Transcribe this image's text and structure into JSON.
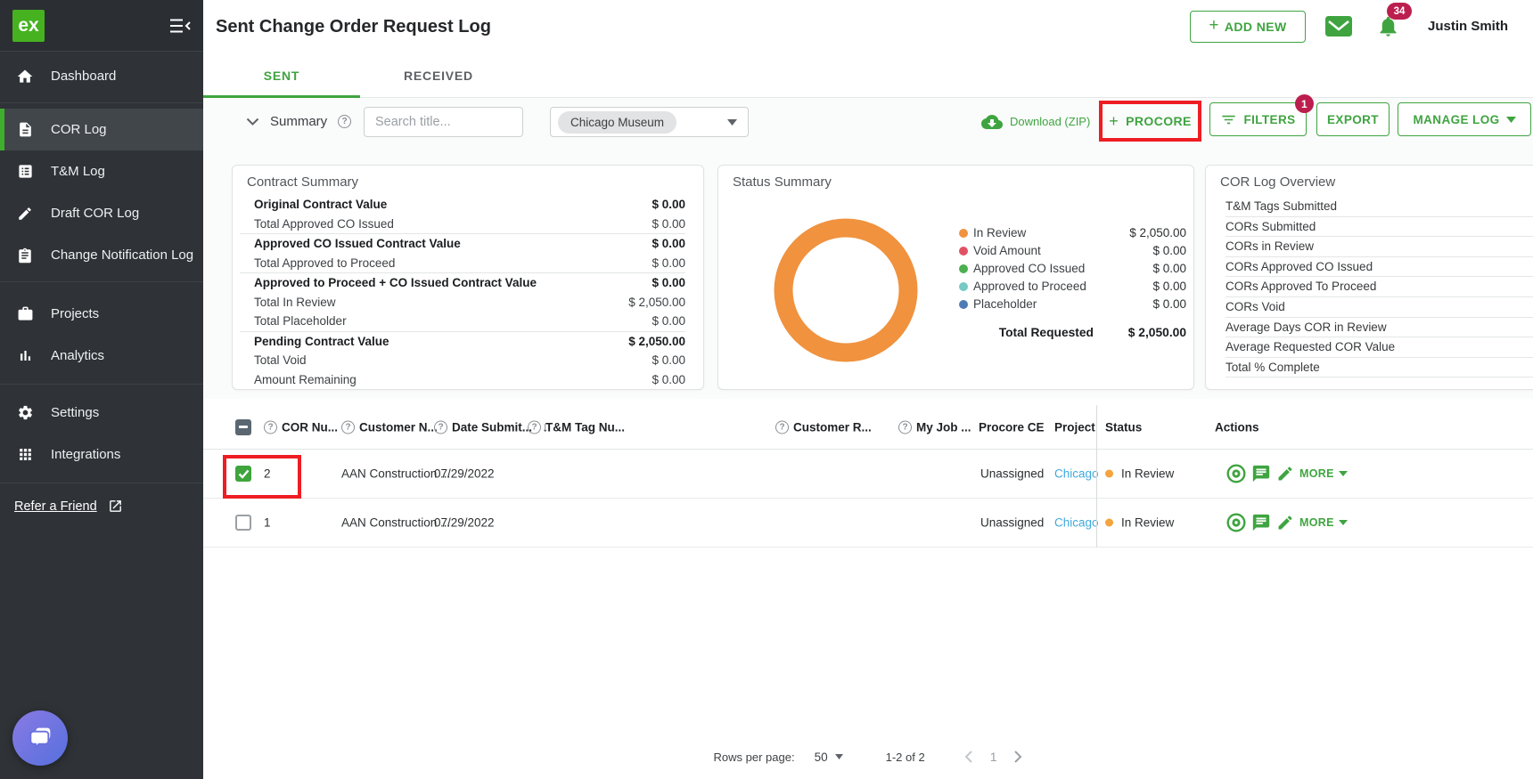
{
  "colors": {
    "accent_green": "#3fa440",
    "logo_green": "#46b220",
    "badge_crimson": "#bc1e4e",
    "annotation_red": "#ee1d23",
    "link_blue": "#3fa9db",
    "status_orange": "#f5a33c",
    "donut_orange": "#f0923e"
  },
  "icons": {
    "plus": "+",
    "sort_desc": "↓",
    "help": "?"
  },
  "app": {
    "logo_text": "ex",
    "user_name": "Justin Smith",
    "notification_count": "34"
  },
  "header": {
    "title": "Sent Change Order Request Log",
    "add_new_label": "ADD NEW"
  },
  "sidebar": {
    "groups": [
      {
        "items": [
          {
            "label": "Dashboard",
            "icon": "home"
          }
        ]
      },
      {
        "items": [
          {
            "label": "COR Log",
            "icon": "document",
            "active": true
          },
          {
            "label": "T&M Log",
            "icon": "list"
          },
          {
            "label": "Draft COR Log",
            "icon": "pencil"
          },
          {
            "label": "Change Notification Log",
            "icon": "clipboard"
          }
        ]
      },
      {
        "items": [
          {
            "label": "Projects",
            "icon": "briefcase"
          },
          {
            "label": "Analytics",
            "icon": "bar-chart"
          }
        ]
      },
      {
        "items": [
          {
            "label": "Settings",
            "icon": "gear"
          },
          {
            "label": "Integrations",
            "icon": "grid"
          }
        ]
      }
    ],
    "refer_label": "Refer a Friend"
  },
  "tabs": [
    {
      "label": "SENT",
      "active": true
    },
    {
      "label": "RECEIVED",
      "active": false
    }
  ],
  "toolbar": {
    "summary_label": "Summary",
    "search_placeholder": "Search title...",
    "project_filter_value": "Chicago Museum",
    "download_label": "Download (ZIP)",
    "procore_label": "PROCORE",
    "filters_label": "FILTERS",
    "filters_badge": "1",
    "export_label": "EXPORT",
    "manage_log_label": "MANAGE LOG"
  },
  "contract_summary": {
    "title": "Contract Summary",
    "rows": [
      {
        "label": "Original Contract Value",
        "value": "$ 0.00",
        "bold": true
      },
      {
        "label": "Total Approved CO Issued",
        "value": "$ 0.00"
      },
      {
        "label": "Approved CO Issued Contract Value",
        "value": "$ 0.00",
        "bold": true
      },
      {
        "label": "Total Approved to Proceed",
        "value": "$ 0.00"
      },
      {
        "label": "Approved to Proceed + CO Issued Contract Value",
        "value": "$ 0.00",
        "bold": true
      },
      {
        "label": "Total In Review",
        "value": "$ 2,050.00"
      },
      {
        "label": "Total Placeholder",
        "value": "$ 0.00"
      },
      {
        "label": "Pending Contract Value",
        "value": "$ 2,050.00",
        "bold": true
      },
      {
        "label": "Total Void",
        "value": "$ 0.00"
      },
      {
        "label": "Amount Remaining",
        "value": "$ 0.00"
      }
    ]
  },
  "status_summary": {
    "title": "Status Summary",
    "legend": [
      {
        "label": "In Review",
        "value": "$ 2,050.00",
        "color": "#f0923e"
      },
      {
        "label": "Void Amount",
        "value": "$ 0.00",
        "color": "#e05263"
      },
      {
        "label": "Approved CO Issued",
        "value": "$ 0.00",
        "color": "#4caf50"
      },
      {
        "label": "Approved to Proceed",
        "value": "$ 0.00",
        "color": "#76c9c5"
      },
      {
        "label": "Placeholder",
        "value": "$ 0.00",
        "color": "#4e7ab5"
      }
    ],
    "total_label": "Total Requested",
    "total_value": "$ 2,050.00",
    "chart_data": {
      "type": "pie",
      "donut": true,
      "title": "Status Summary",
      "labels": [
        "In Review",
        "Void Amount",
        "Approved CO Issued",
        "Approved to Proceed",
        "Placeholder"
      ],
      "values": [
        2050,
        0,
        0,
        0,
        0
      ],
      "colors": [
        "#f0923e",
        "#e05263",
        "#4caf50",
        "#76c9c5",
        "#4e7ab5"
      ],
      "total_label": "Total Requested",
      "total_value": 2050,
      "legend_position": "right"
    }
  },
  "cor_log_overview": {
    "title": "COR Log Overview",
    "rows": [
      "T&M Tags Submitted",
      "CORs Submitted",
      "CORs in Review",
      "CORs Approved CO Issued",
      "CORs Approved To Proceed",
      "CORs Void",
      "Average Days COR in Review",
      "Average Requested COR Value",
      "Total % Complete"
    ]
  },
  "table": {
    "columns": [
      {
        "label": "COR Nu...",
        "help": true
      },
      {
        "label": "Customer N...",
        "help": true
      },
      {
        "label": "Date Submit...",
        "help": true,
        "sort": "desc"
      },
      {
        "label": "T&M Tag Nu...",
        "help": true
      },
      {
        "label": "Customer R...",
        "help": true
      },
      {
        "label": "My Job ...",
        "help": true
      },
      {
        "label": "Procore CE",
        "help": false
      },
      {
        "label": "Project Na",
        "help": false
      },
      {
        "label": "Status",
        "help": false
      },
      {
        "label": "Actions",
        "help": false
      }
    ],
    "more_label": "MORE",
    "rows": [
      {
        "selected": true,
        "cor_number": "2",
        "customer_name": "AAN Construction ...",
        "date_submitted": "07/29/2022",
        "tm_tag_number": "",
        "customer_request": "",
        "my_job": "",
        "procore_ce": "Unassigned",
        "project_name": "Chicago M",
        "status": "In Review"
      },
      {
        "selected": false,
        "cor_number": "1",
        "customer_name": "AAN Construction ...",
        "date_submitted": "07/29/2022",
        "tm_tag_number": "",
        "customer_request": "",
        "my_job": "",
        "procore_ce": "Unassigned",
        "project_name": "Chicago M",
        "status": "In Review"
      }
    ]
  },
  "pagination": {
    "rows_per_page_label": "Rows per page:",
    "rows_per_page_value": "50",
    "range_text": "1-2 of 2",
    "current_page": "1"
  }
}
